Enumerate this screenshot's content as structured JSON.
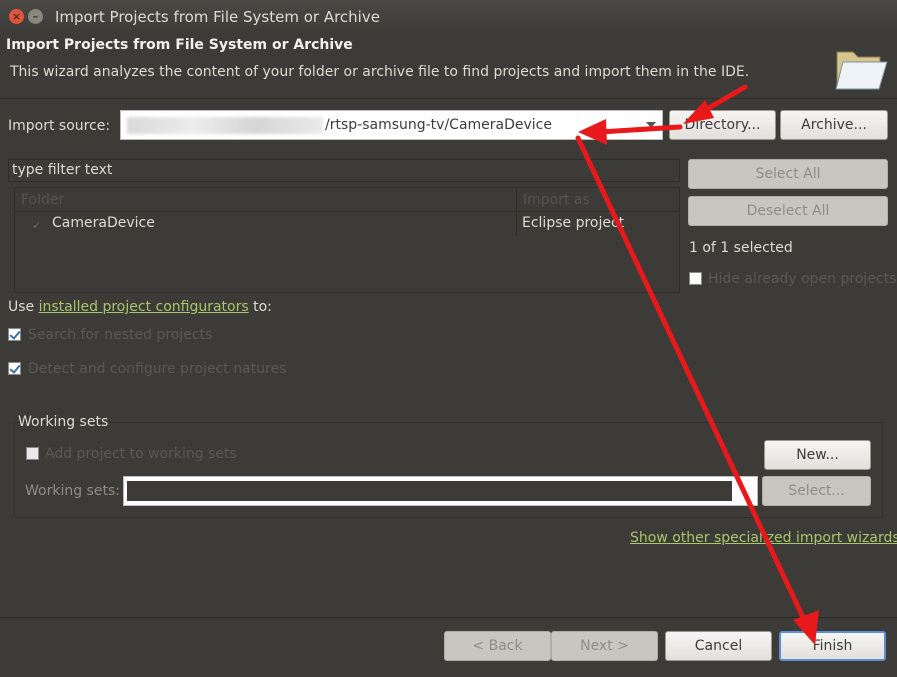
{
  "window": {
    "title": "Import Projects from File System or Archive",
    "close": "×",
    "minimize": "–"
  },
  "header": {
    "title": "Import Projects from File System or Archive",
    "description": "This wizard analyzes the content of your folder or archive file to find projects and import them in the IDE.",
    "icon": "folder-icon"
  },
  "source": {
    "label": "Import source:",
    "value_suffix": "/rtsp-samsung-tv/CameraDevice",
    "directory_button": "Directory...",
    "archive_button": "Archive..."
  },
  "filter": {
    "placeholder": "type filter text"
  },
  "tree": {
    "columns": [
      "Folder",
      "Import as"
    ],
    "rows": [
      {
        "folder": "CameraDevice",
        "import_as": "Eclipse project",
        "checked": true
      }
    ]
  },
  "selection": {
    "select_all": "Select All",
    "deselect_all": "Deselect All",
    "count": "1 of 1 selected",
    "hide_open": "Hide already open projects"
  },
  "configurators": {
    "prefix": "Use ",
    "link": "installed project configurators",
    "suffix": " to:",
    "nested": "Search for nested projects",
    "natures": "Detect and configure project natures"
  },
  "working_sets": {
    "title": "Working sets",
    "add": "Add project to working sets",
    "new_button": "New...",
    "field_label": "Working sets:",
    "select_button": "Select..."
  },
  "other_wizards_link": "Show other specialized import wizards",
  "footer": {
    "back": "< Back",
    "next": "Next >",
    "cancel": "Cancel",
    "finish": "Finish"
  },
  "colors": {
    "annotation_arrow": "#e8191a",
    "link": "#a9c66b",
    "background": "#3c3b37"
  }
}
